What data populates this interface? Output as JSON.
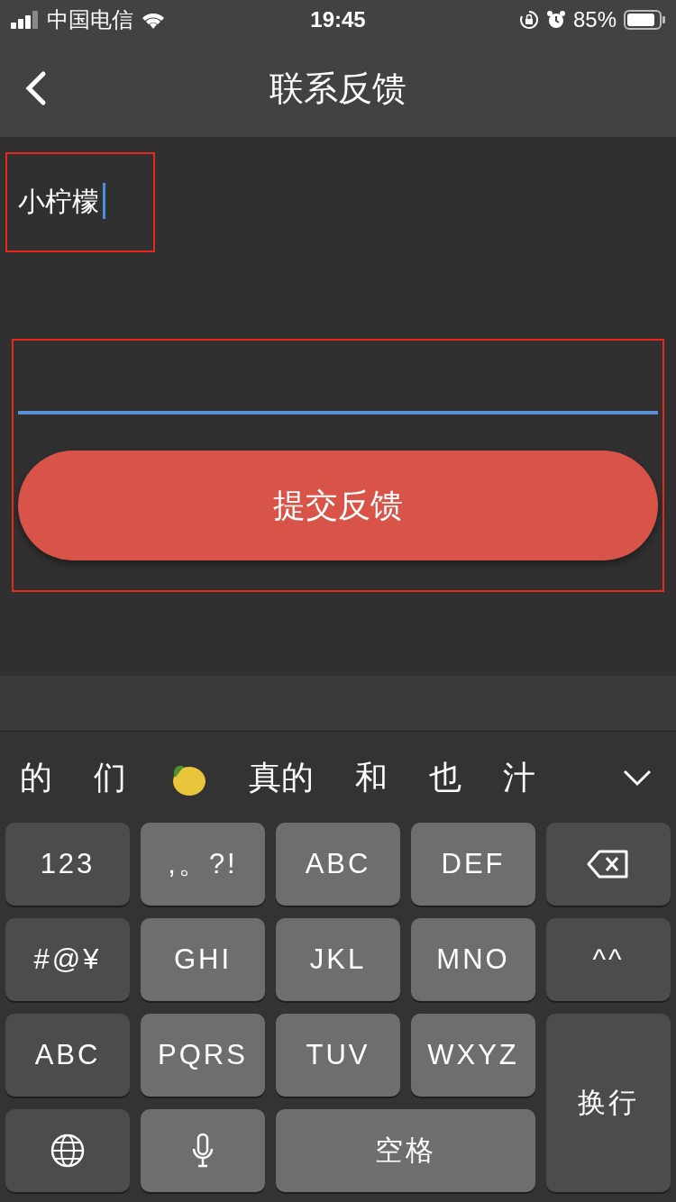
{
  "status_bar": {
    "carrier": "中国电信",
    "time": "19:45",
    "battery": "85%"
  },
  "nav": {
    "title": "联系反馈"
  },
  "form": {
    "name_field": {
      "value": "小柠檬",
      "focused": true
    },
    "feedback_field": {
      "focused": true
    },
    "submit": "提交反馈"
  },
  "keyboard": {
    "candidates": [
      {
        "kind": "text",
        "text": "的"
      },
      {
        "kind": "text",
        "text": "们"
      },
      {
        "kind": "lemon"
      },
      {
        "kind": "text",
        "text": "真的"
      },
      {
        "kind": "text",
        "text": "和"
      },
      {
        "kind": "text",
        "text": "也"
      },
      {
        "kind": "text",
        "text": "汁"
      }
    ],
    "keys": [
      {
        "kind": "text",
        "label": "123",
        "dark": true
      },
      {
        "kind": "text",
        "label": ",。?!",
        "dark": false
      },
      {
        "kind": "text",
        "label": "ABC",
        "dark": false
      },
      {
        "kind": "text",
        "label": "DEF",
        "dark": false
      },
      {
        "kind": "backspace",
        "dark": true
      },
      {
        "kind": "text",
        "label": "#@¥",
        "dark": true
      },
      {
        "kind": "text",
        "label": "GHI",
        "dark": false
      },
      {
        "kind": "text",
        "label": "JKL",
        "dark": false
      },
      {
        "kind": "text",
        "label": "MNO",
        "dark": false
      },
      {
        "kind": "text",
        "label": "^^",
        "dark": true
      },
      {
        "kind": "text",
        "label": "ABC",
        "dark": true
      },
      {
        "kind": "text",
        "label": "PQRS",
        "dark": false
      },
      {
        "kind": "text",
        "label": "TUV",
        "dark": false
      },
      {
        "kind": "text",
        "label": "WXYZ",
        "dark": false
      },
      {
        "kind": "text",
        "label": "换行",
        "dark": true,
        "tall": true
      },
      {
        "kind": "globe",
        "dark": true
      },
      {
        "kind": "mic",
        "dark": false
      },
      {
        "kind": "text",
        "label": "空格",
        "dark": false,
        "wide": true
      }
    ]
  }
}
